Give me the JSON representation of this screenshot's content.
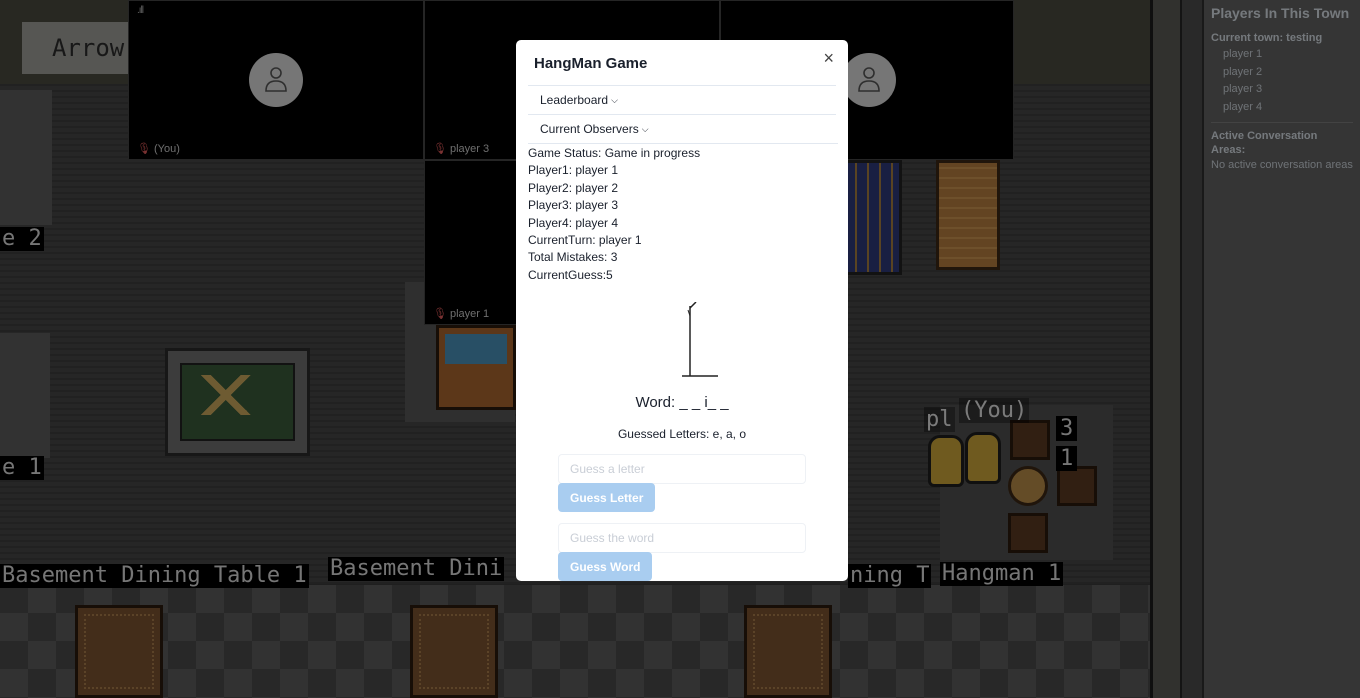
{
  "game": {
    "arrow_button": "Arrow",
    "labels": {
      "left_top": "e 2",
      "left_mid": "e 1",
      "table1": "Basement Dining Table 1",
      "table2": "Basement Dini",
      "table3_tail": "ning T",
      "hangman": "Hangman 1",
      "player_tag": "pl",
      "you_tag": "(You)",
      "num_3": "3",
      "num_1": "1"
    }
  },
  "video": {
    "tiles": [
      {
        "label": "(You)",
        "icon": "person-icon"
      },
      {
        "label": "player 3",
        "icon": "person-icon"
      },
      {
        "label": "",
        "icon": "person-icon"
      },
      {
        "label": "player 1",
        "icon": "person-icon"
      }
    ],
    "signal": ".ıll"
  },
  "sidebar": {
    "title": "Players In This Town",
    "current_town": "Current town: testing",
    "players": [
      "player 1",
      "player 2",
      "player 3",
      "player 4"
    ],
    "active_title": "Active Conversation Areas:",
    "no_active": "No active conversation areas"
  },
  "modal": {
    "title": "HangMan Game",
    "close": "×",
    "leaderboard": "Leaderboard",
    "observers": "Current Observers",
    "status_lines": [
      "Game Status: Game in progress",
      "Player1: player 1",
      "Player2: player 2",
      "Player3: player 3",
      "Player4: player 4",
      "CurrentTurn: player 1",
      "Total Mistakes: 3",
      "CurrentGuess:5"
    ],
    "word": "Word: _ _ i_ _",
    "guessed": "Guessed Letters: e, a, o",
    "letter_placeholder": "Guess a letter",
    "letter_button": "Guess Letter",
    "word_placeholder": "Guess the word",
    "word_button": "Guess Word"
  }
}
